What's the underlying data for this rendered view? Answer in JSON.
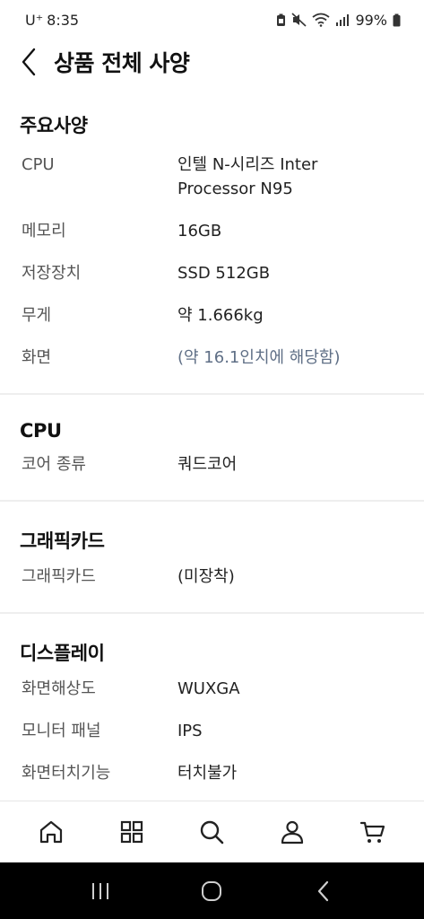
{
  "status_bar": {
    "carrier": "U⁺",
    "time": "8:35",
    "battery": "99%"
  },
  "header": {
    "title": "상품 전체 사양"
  },
  "sections": [
    {
      "title": "주요사양",
      "rows": [
        {
          "label": "CPU",
          "value_lines": [
            "인텔 N-시리즈 Inter",
            "Processor N95"
          ]
        },
        {
          "label": "메모리",
          "value_lines": [
            "16GB"
          ]
        },
        {
          "label": "저장장치",
          "value_lines": [
            "SSD 512GB"
          ]
        },
        {
          "label": "무게",
          "value_lines": [
            "약 1.666kg"
          ]
        },
        {
          "label": "화면",
          "value_lines": [
            "(약 16.1인치에 해당함)"
          ]
        }
      ]
    },
    {
      "title": "CPU",
      "rows": [
        {
          "label": "코어 종류",
          "value_lines": [
            "쿼드코어"
          ]
        }
      ]
    },
    {
      "title": "그래픽카드",
      "rows": [
        {
          "label": "그래픽카드",
          "value_lines": [
            "(미장착)"
          ]
        }
      ]
    },
    {
      "title": "디스플레이",
      "rows": [
        {
          "label": "화면해상도",
          "value_lines": [
            "WUXGA"
          ]
        },
        {
          "label": "모니터 패널",
          "value_lines": [
            "IPS"
          ]
        },
        {
          "label": "화면터치기능",
          "value_lines": [
            "터치불가"
          ]
        }
      ]
    }
  ],
  "bottom_nav": [
    "home-icon",
    "category-grid-icon",
    "search-icon",
    "user-icon",
    "cart-icon"
  ],
  "system_nav": [
    "recent-apps-icon",
    "home-circle-icon",
    "system-back-icon"
  ],
  "colors": {
    "muted_value": "#5f6f86",
    "divider": "#eeeeee",
    "system_bar": "#000000"
  }
}
